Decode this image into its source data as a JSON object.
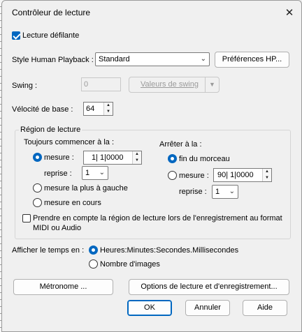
{
  "window": {
    "title": "Contrôleur de lecture",
    "close_glyph": "✕"
  },
  "scrolling": {
    "label": "Lecture défilante",
    "checked": true
  },
  "human_playback": {
    "label": "Style Human Playback :",
    "value": "Standard",
    "prefs_button": "Préférences HP..."
  },
  "swing": {
    "label": "Swing :",
    "value": "0",
    "values_button": "Valeurs de swing"
  },
  "velocity": {
    "label": "Vélocité de base :",
    "value": "64"
  },
  "region": {
    "title": "Région de lecture",
    "always_start": "Toujours commencer à la :",
    "start_measure_label": "mesure :",
    "start_measure_value": "1|  1|0000",
    "start_reprise_label": "reprise :",
    "start_reprise_value": "1",
    "leftmost": "mesure la plus à gauche",
    "current": "mesure en cours",
    "stop_at": "Arrêter à la :",
    "end_of_piece": "fin du morceau",
    "stop_measure_label": "mesure :",
    "stop_measure_value": "90|  1|0000",
    "stop_reprise_label": "reprise :",
    "stop_reprise_value": "1",
    "record_note": "Prendre en compte la région de lecture lors de l'enregistrement au format MIDI ou Audio"
  },
  "time_display": {
    "label": "Afficher le temps en :",
    "option_hms": "Heures:Minutes:Secondes.Millisecondes",
    "option_frames": "Nombre d'images"
  },
  "buttons": {
    "metronome": "Métronome ...",
    "options": "Options de lecture et d'enregistrement...",
    "ok": "OK",
    "cancel": "Annuler",
    "help": "Aide"
  },
  "icons": {
    "chevron": "⌄",
    "spin_up": "▲",
    "spin_down": "▼"
  },
  "colors": {
    "accent": "#0067c0",
    "background": "#f0f0f0"
  }
}
